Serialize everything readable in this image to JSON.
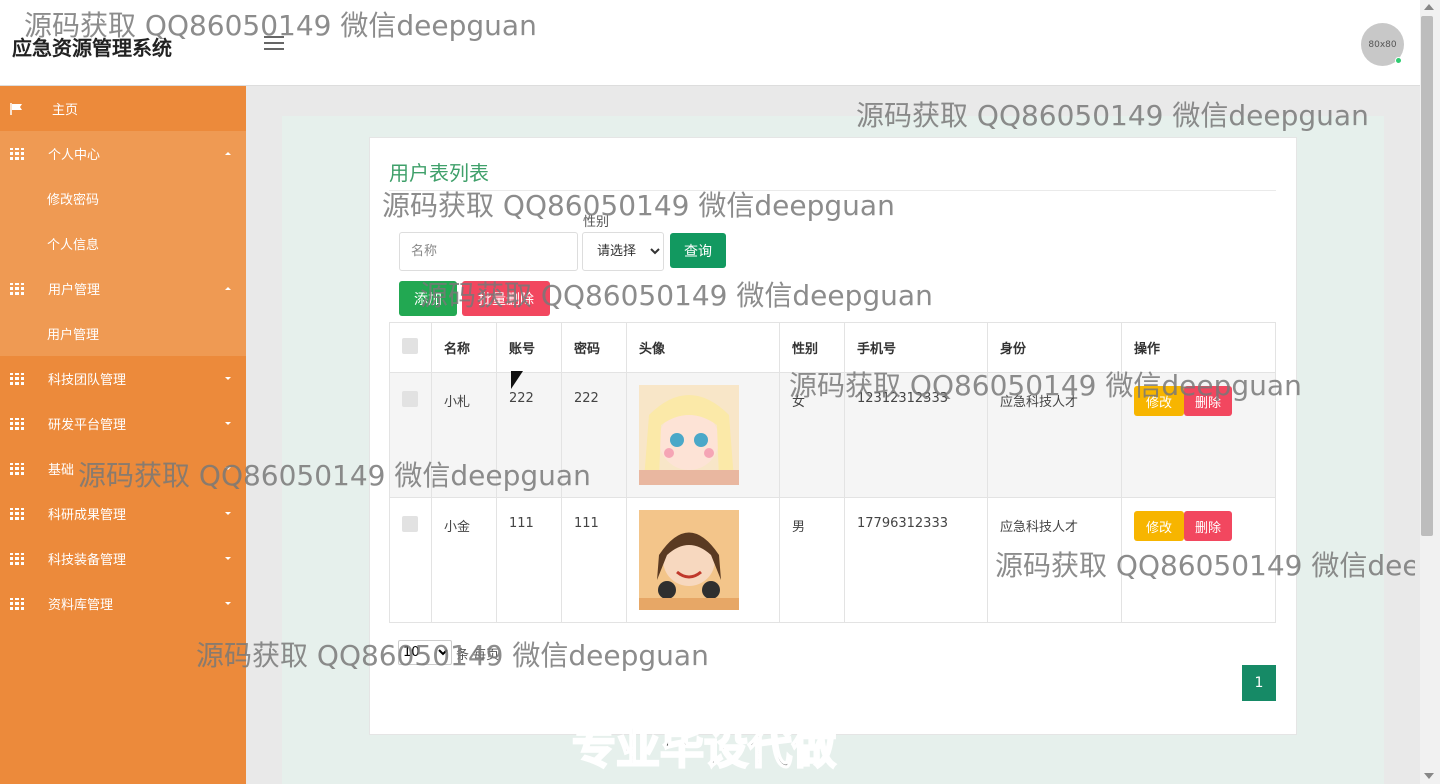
{
  "app": {
    "title": "应急资源管理系统",
    "avatar_text": "80x80"
  },
  "sidebar": {
    "items": [
      {
        "label": "主页",
        "icon": "flag-icon"
      },
      {
        "label": "个人中心",
        "icon": "grid-icon",
        "expanded": true
      },
      {
        "label": "修改密码",
        "sub": true
      },
      {
        "label": "个人信息",
        "sub": true
      },
      {
        "label": "用户管理",
        "icon": "grid-icon",
        "expanded": true
      },
      {
        "label": "用户管理",
        "sub": true
      },
      {
        "label": "科技团队管理",
        "icon": "grid-icon"
      },
      {
        "label": "研发平台管理",
        "icon": "grid-icon"
      },
      {
        "label": "基础",
        "icon": "grid-icon"
      },
      {
        "label": "科研成果管理",
        "icon": "grid-icon"
      },
      {
        "label": "科技装备管理",
        "icon": "grid-icon"
      },
      {
        "label": "资料库管理",
        "icon": "grid-icon"
      }
    ]
  },
  "main": {
    "title": "用户表列表",
    "search": {
      "name_placeholder": "名称",
      "gender_label": "性别",
      "gender_selected": "请选择",
      "query_label": "查询"
    },
    "actions": {
      "add_label": "添加",
      "batch_delete_label": "批量删除"
    },
    "table": {
      "headers": [
        "名称",
        "账号",
        "密码",
        "头像",
        "性别",
        "手机号",
        "身份",
        "操作"
      ],
      "rows": [
        {
          "name": "小札",
          "account": "222",
          "password": "222",
          "gender": "女",
          "phone": "12312312333",
          "role": "应急科技人才",
          "edit": "修改",
          "delete": "删除"
        },
        {
          "name": "小金",
          "account": "111",
          "password": "111",
          "gender": "男",
          "phone": "17796312333",
          "role": "应急科技人才",
          "edit": "修改",
          "delete": "删除"
        }
      ]
    },
    "pagination": {
      "page_size": "10",
      "page_size_label": "条 每页",
      "current_page": "1"
    }
  },
  "overlays": {
    "watermark": "源码获取 QQ86050149 微信deepguan",
    "banner": "专业毕设代做"
  },
  "colors": {
    "sidebar": "#ec8a3b",
    "accent_green": "#129960",
    "danger": "#f2475f",
    "warning": "#f7b500"
  }
}
